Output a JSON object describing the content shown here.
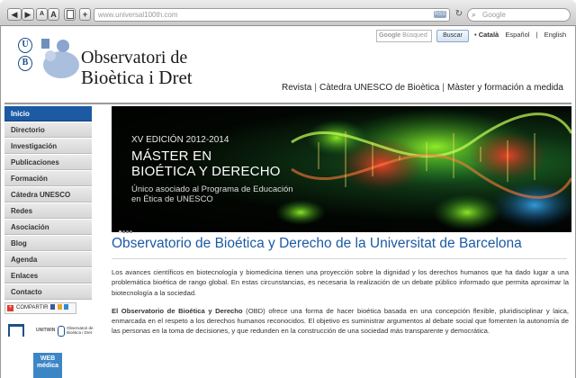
{
  "browser": {
    "url": "www.universal100th.com",
    "search_placeholder": "Google",
    "rss": "RSS",
    "buttons": {
      "back": "◀",
      "forward": "▶",
      "text_small": "A",
      "text_large": "A",
      "bookmark": "+"
    }
  },
  "header": {
    "logo_letters": [
      "U",
      "B"
    ],
    "title_line1": "Observatori de",
    "title_line2": "Bioètica i Dret",
    "google_search": {
      "brand": "Google",
      "placeholder": "Búsqued",
      "button": "Buscar"
    },
    "languages": [
      "Català",
      "Español",
      "English"
    ],
    "top_nav": [
      "Revista",
      "Càtedra UNESCO de Bioètica",
      "Màster y formación a medida"
    ]
  },
  "sidebar": {
    "items": [
      {
        "label": "Inicio",
        "active": true
      },
      {
        "label": "Directorio"
      },
      {
        "label": "Investigación"
      },
      {
        "label": "Publicaciones"
      },
      {
        "label": "Formación"
      },
      {
        "label": "Cátedra UNESCO"
      },
      {
        "label": "Redes"
      },
      {
        "label": "Asociación"
      },
      {
        "label": "Blog"
      },
      {
        "label": "Agenda"
      },
      {
        "label": "Enlaces"
      },
      {
        "label": "Contacto"
      }
    ],
    "share_label": "COMPARTIR",
    "unitwin": "UNITWIN",
    "mini_obs": "Observatori de Bioètica i Dret",
    "webmedica": {
      "line1": "WEB",
      "line2": "médica"
    }
  },
  "banner": {
    "edition": "XV EDICIÓN 2012-2014",
    "title_line1": "MÁSTER EN",
    "title_line2": "BIOÉTICA Y DERECHO",
    "subtitle": "Único asociado al Programa de Educación en Ética de UNESCO",
    "slides": 4,
    "active_slide": 0
  },
  "main": {
    "heading": "Observatorio de Bioética y Derecho de la Universitat de Barcelona",
    "paragraph1": "Los avances científicos en biotecnología y biomedicina tienen una proyección sobre la dignidad y los derechos humanos que ha dado lugar a una problemática bioética de rango global. En estas circunstancias, es necesaria la realización de un debate público informado que permita aproximar la biotecnología a la sociedad.",
    "paragraph2_lead": "El Observatorio de Bioética y Derecho",
    "paragraph2_rest": " (OBD) ofrece una forma de hacer bioética basada en una concepción flexible, pluridisciplinar y laica, enmarcada en el respeto a los derechos humanos reconocidos. El objetivo es suministrar argumentos al debate social que fomenten la autonomía de las personas en la toma de decisiones, y que redunden en la construcción de una sociedad más transparente y democrática."
  },
  "colors": {
    "accent": "#1c5aa4",
    "banner_glow": "#1d6d27"
  }
}
